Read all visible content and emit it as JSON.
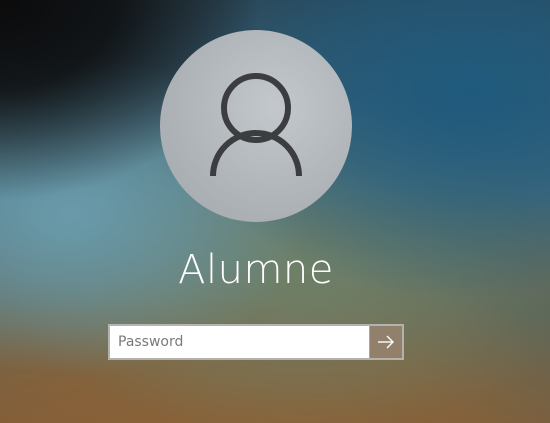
{
  "user": {
    "name": "Alumne"
  },
  "password": {
    "placeholder": "Password",
    "value": ""
  },
  "icons": {
    "avatar": "user-silhouette-icon",
    "submit": "arrow-right-icon"
  },
  "colors": {
    "avatar_bg": "#b3b8bc",
    "avatar_glyph": "#3b3d40",
    "text": "#ffffff",
    "input_bg": "#ffffff",
    "button_bg": "#968270"
  }
}
